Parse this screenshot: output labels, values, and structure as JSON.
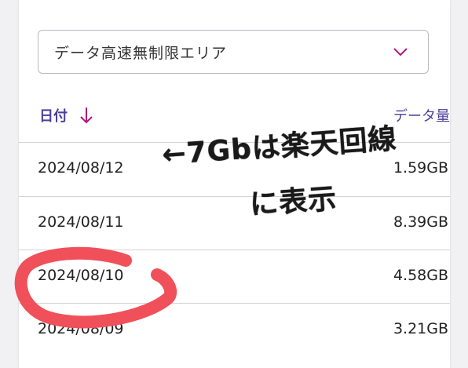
{
  "filter": {
    "selected": "データ高速無制限エリア",
    "icon": "chevron-down-icon"
  },
  "table": {
    "col_date": "日付",
    "col_data": "データ量",
    "sort_icon": "arrow-down-icon",
    "rows": [
      {
        "date": "2024/08/12",
        "usage": "1.59GB"
      },
      {
        "date": "2024/08/11",
        "usage": "8.39GB"
      },
      {
        "date": "2024/08/10",
        "usage": "4.58GB"
      },
      {
        "date": "2024/08/09",
        "usage": "3.21GB"
      }
    ]
  },
  "annotation": {
    "line1": "←7Gbは楽天回線",
    "line2": "に表示",
    "circle_color": "#f0505a"
  },
  "colors": {
    "accent": "#4a3f9c",
    "chevron": "#b0177a"
  }
}
